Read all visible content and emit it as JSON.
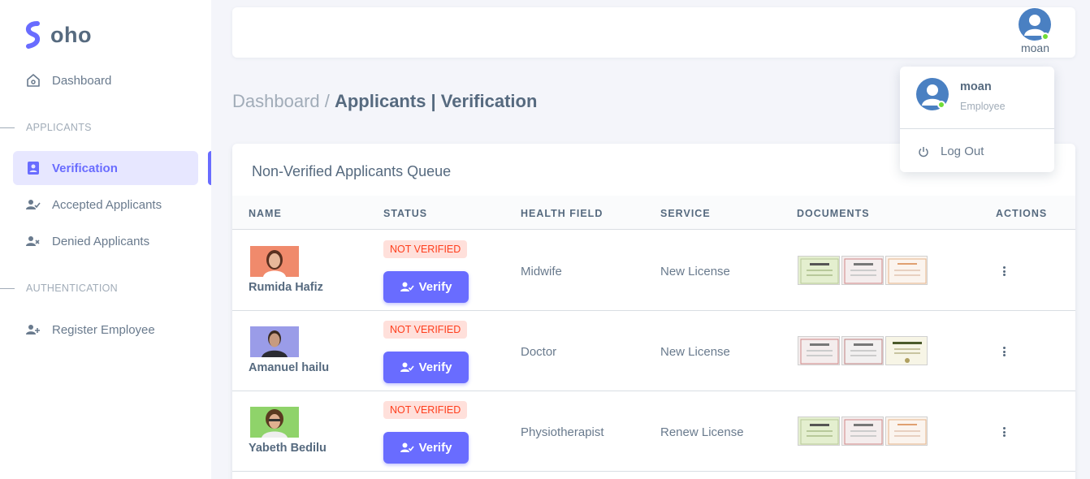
{
  "brand": {
    "name": "oho",
    "color": "#696cff"
  },
  "sidebar": {
    "items": [
      {
        "label": "Dashboard",
        "icon": "home-icon"
      },
      {
        "label": "Verification",
        "icon": "user-badge-icon",
        "active": true
      },
      {
        "label": "Accepted Applicants",
        "icon": "user-check-icon"
      },
      {
        "label": "Denied Applicants",
        "icon": "user-x-icon"
      },
      {
        "label": "Register Employee",
        "icon": "user-plus-icon"
      }
    ],
    "sections": {
      "applicants": "APPLICANTS",
      "authentication": "AUTHENTICATION"
    }
  },
  "topbar": {
    "username": "moan",
    "status_color": "#71dd37"
  },
  "breadcrumb": {
    "parent": "Dashboard / ",
    "current": "Applicants | Verification"
  },
  "card": {
    "title": "Non-Verified Applicants Queue",
    "columns": [
      "NAME",
      "STATUS",
      "HEALTH FIELD",
      "SERVICE",
      "DOCUMENTS",
      "ACTIONS"
    ],
    "verify_label": "Verify",
    "rows": [
      {
        "name": "Rumida Hafiz",
        "status": "NOT VERIFIED",
        "health_field": "Midwife",
        "service": "New License",
        "photo_bg": "#f08a6c"
      },
      {
        "name": "Amanuel hailu",
        "status": "NOT VERIFIED",
        "health_field": "Doctor",
        "service": "New License",
        "photo_bg": "#9a9ce8"
      },
      {
        "name": "Yabeth Bedilu",
        "status": "NOT VERIFIED",
        "health_field": "Physiotherapist",
        "service": "Renew License",
        "photo_bg": "#8fd36a"
      }
    ]
  },
  "dropdown": {
    "name": "moan",
    "role": "Employee",
    "logout": "Log Out"
  },
  "colors": {
    "primary": "#696cff",
    "danger": "#ff3e1d",
    "danger_bg": "#ffe0db",
    "text": "#566a7f",
    "muted": "#a1acb8"
  }
}
